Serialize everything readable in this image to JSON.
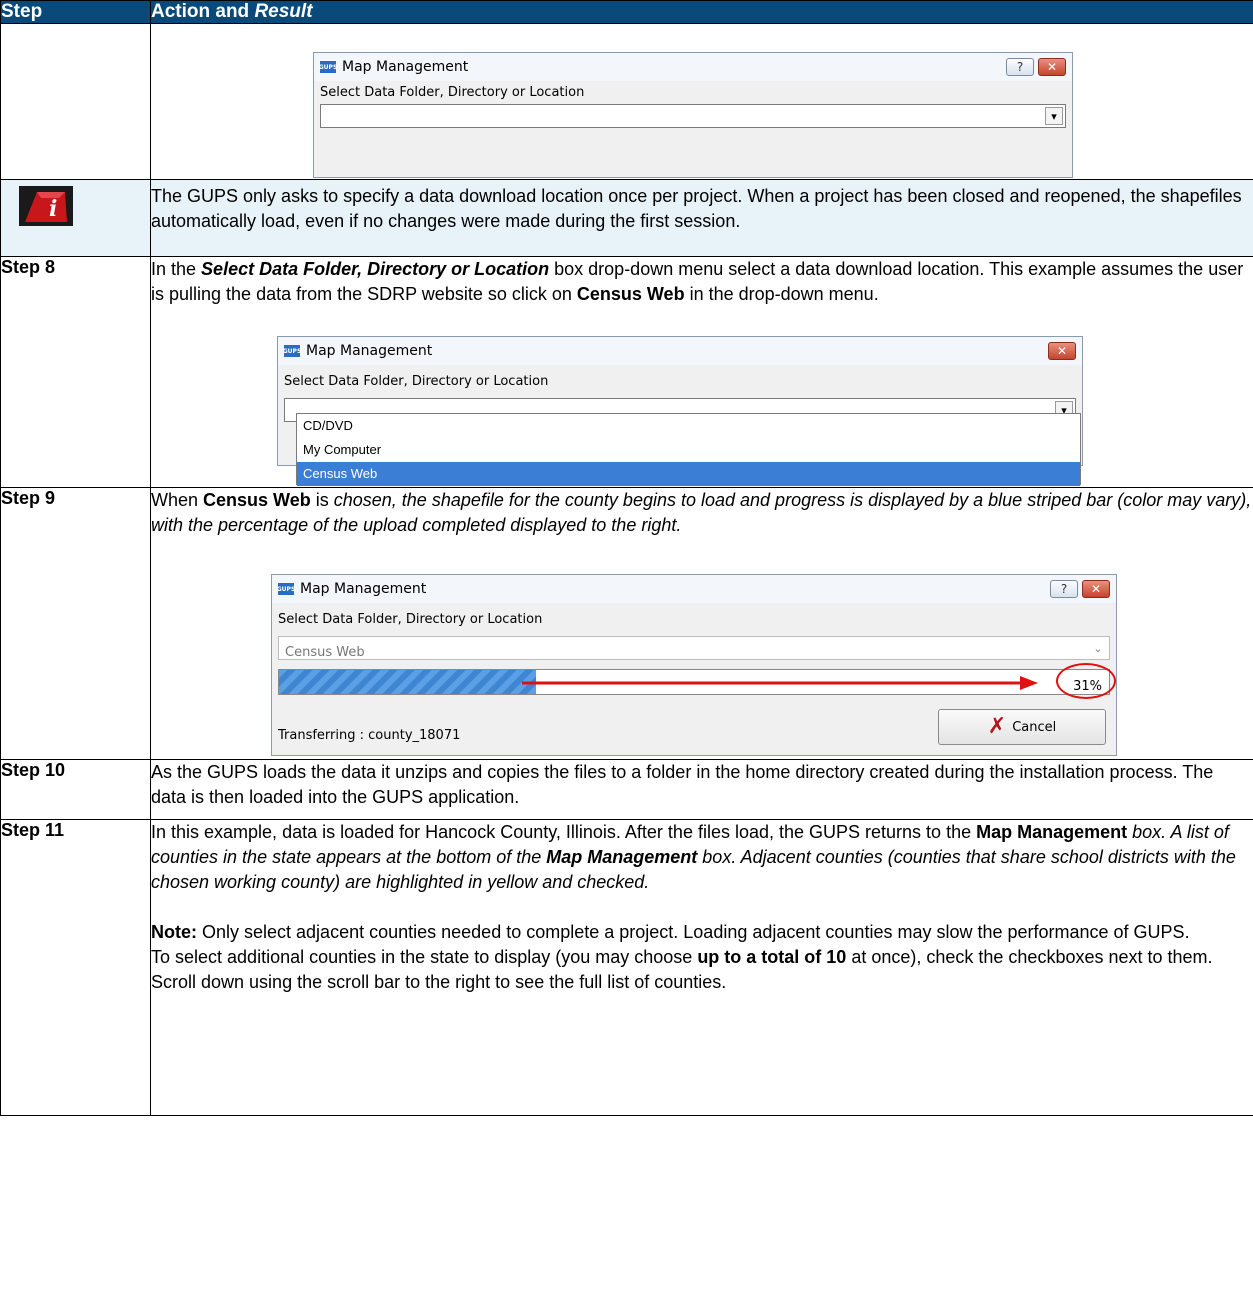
{
  "header": {
    "step": "Step",
    "action_plain": "Action and ",
    "action_italic": "Result"
  },
  "dialog_common": {
    "title": "Map Management",
    "label": "Select Data Folder, Directory or Location",
    "icon_text": "GUPS"
  },
  "note": {
    "text": "The GUPS only asks to specify a data download location once per project. When a project has been closed and reopened, the shapefiles automatically load, even if no changes were made during the first session."
  },
  "step8": {
    "label": "Step 8",
    "t1": "In the ",
    "b1": "Select Data Folder, Directory or Location",
    "t2": " box drop-down menu select a data download location. This example assumes the user is pulling the data from the SDRP website so click on ",
    "b2": "Census Web",
    "t3": " in the drop-down menu.",
    "options": [
      "CD/DVD",
      "My Computer",
      "Census Web"
    ]
  },
  "step9": {
    "label": "Step 9",
    "t1": "When ",
    "b1": "Census Web",
    "t2": " is ",
    "i1": "chosen, the shapefile for the county begins to load and progress is displayed by a blue striped bar (color may vary), with the percentage of the upload completed displayed to the right.",
    "combo_value": "Census Web",
    "progress": 0.31,
    "percent": "31%",
    "status": "Transferring : county_18071",
    "cancel": "Cancel"
  },
  "step10": {
    "label": "Step 10",
    "text": "As the GUPS loads the data it unzips and copies the files to a folder in the home directory created during the installation process. The data is then loaded into the GUPS application."
  },
  "step11": {
    "label": "Step 11",
    "t1": "In this example, data is loaded for Hancock County, Illinois. After the files load, the GUPS returns to the ",
    "b1": "Map Management",
    "t2": " box",
    "i1": ". A list of counties in the state appears at the bottom of the ",
    "bi1": "Map Management",
    "i2": " box. Adjacent counties (counties that share school districts with the chosen working county) are highlighted in yellow and checked.",
    "note_label": "Note:",
    "note_text": "  Only select adjacent counties needed to complete a project. Loading adjacent counties may slow the performance of GUPS.",
    "t3": "To select additional counties in the state to display (you may choose ",
    "b2": "up to a total of 10",
    "t4": " at once), check the checkboxes next to them. Scroll down using the scroll bar to the right to see the full list of counties."
  }
}
